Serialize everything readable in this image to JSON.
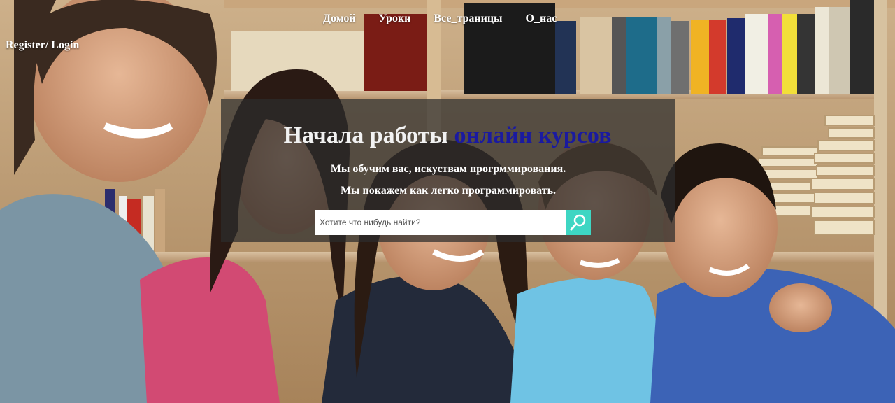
{
  "auth": {
    "label": "Register/ Login"
  },
  "nav": {
    "items": [
      {
        "label": "Домой"
      },
      {
        "label": "Уроки"
      },
      {
        "label": "Все_траницы"
      },
      {
        "label": "О_нас"
      }
    ]
  },
  "hero": {
    "title_main": "Начала работы",
    "title_accent": "онлайн курсов",
    "line1": "Мы обучим вас, искуствам прогрммирования.",
    "line2": "Мы покажем как легко программировать."
  },
  "search": {
    "placeholder": "Хотите что нибудь найти?",
    "value": "",
    "button_icon": "search-icon"
  },
  "colors": {
    "accent": "#1a1aa0",
    "search_button": "#3ed6c3"
  }
}
